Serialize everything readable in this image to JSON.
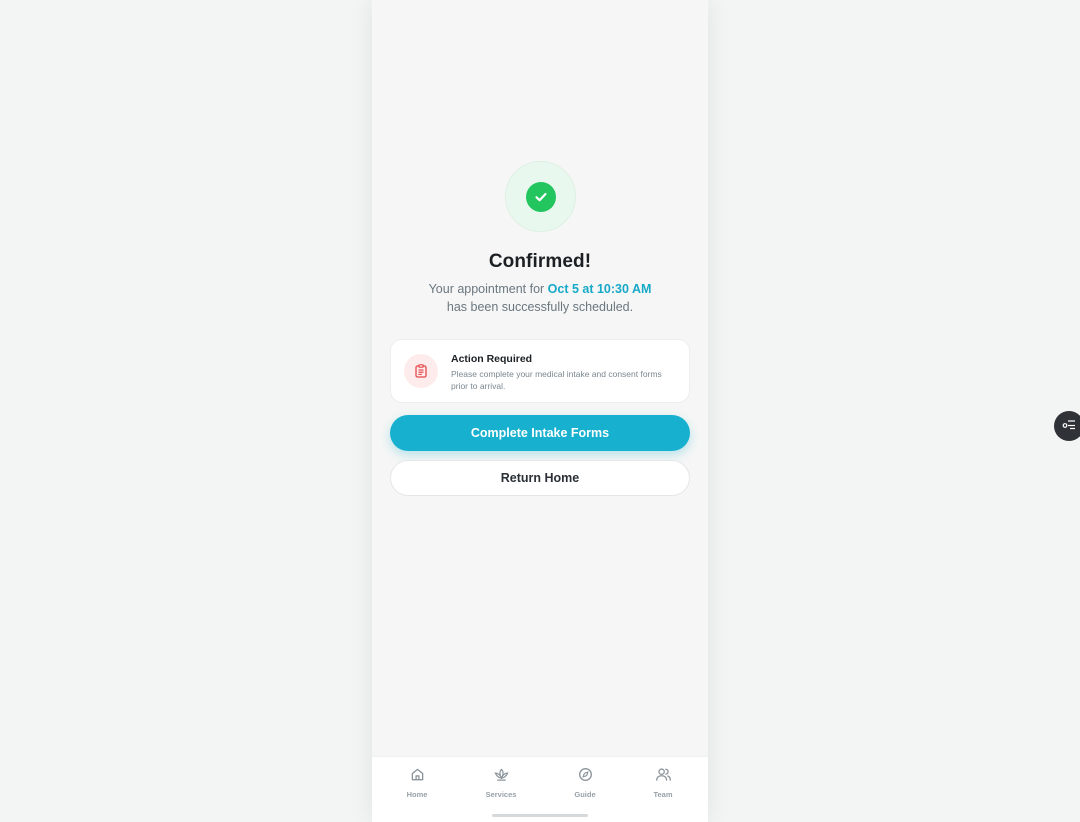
{
  "confirmation": {
    "title": "Confirmed!",
    "subtitle_prefix": "Your appointment for ",
    "appointment_time": "Oct 5 at 10:30 AM",
    "subtitle_suffix": "has been successfully scheduled."
  },
  "action_card": {
    "icon": "clipboard-icon",
    "title": "Action Required",
    "text": "Please complete your medical intake and consent forms prior to arrival."
  },
  "buttons": {
    "primary_label": "Complete Intake Forms",
    "secondary_label": "Return Home"
  },
  "tabbar": {
    "items": [
      {
        "label": "Home",
        "icon": "home-icon"
      },
      {
        "label": "Services",
        "icon": "lotus-icon"
      },
      {
        "label": "Guide",
        "icon": "compass-icon"
      },
      {
        "label": "Team",
        "icon": "users-icon"
      }
    ]
  },
  "colors": {
    "accent": "#17b0cf",
    "success": "#22c55e",
    "warning": "#e5484d"
  }
}
